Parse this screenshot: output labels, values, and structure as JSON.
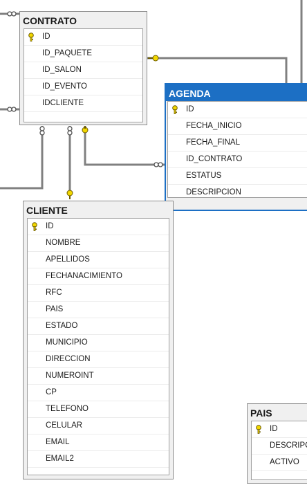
{
  "tables": {
    "contrato": {
      "title": "CONTRATO",
      "columns": [
        "ID",
        "ID_PAQUETE",
        "ID_SALON",
        "ID_EVENTO",
        "IDCLIENTE"
      ]
    },
    "agenda": {
      "title": "AGENDA",
      "columns": [
        "ID",
        "FECHA_INICIO",
        "FECHA_FINAL",
        "ID_CONTRATO",
        "ESTATUS",
        "DESCRIPCION"
      ]
    },
    "cliente": {
      "title": "CLIENTE",
      "columns": [
        "ID",
        "NOMBRE",
        "APELLIDOS",
        "FECHANACIMIENTO",
        "RFC",
        "PAIS",
        "ESTADO",
        "MUNICIPIO",
        "DIRECCION",
        "NUMEROINT",
        "CP",
        "TELEFONO",
        "CELULAR",
        "EMAIL",
        "EMAIL2"
      ]
    },
    "pais": {
      "title": "PAIS",
      "columns": [
        "ID",
        "DESCRIPCI",
        "ACTIVO"
      ]
    }
  },
  "icons": {
    "primary_key": "key-icon",
    "relationship_one": "key-endpoint-icon",
    "relationship_many": "infinity-endpoint-icon"
  },
  "colors": {
    "selected_border": "#1c6fc4",
    "key_yellow": "#f2d700",
    "line": "#808080"
  }
}
